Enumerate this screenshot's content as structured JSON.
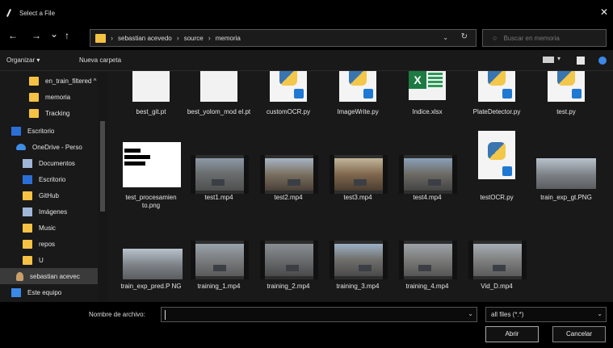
{
  "window": {
    "title": "Select a File",
    "close_glyph": "✕"
  },
  "nav": {
    "back": "←",
    "forward": "→",
    "recent": "⌄",
    "up": "↑",
    "breadcrumbs": [
      "sebastian acevedo",
      "source",
      "memoria"
    ],
    "dropdown_glyph": "⌄",
    "refresh_glyph": "↻",
    "search_placeholder": "Buscar en memoria"
  },
  "toolbar": {
    "organize": "Organizar ▾",
    "new_folder": "Nueva carpeta"
  },
  "sidebar": {
    "items": [
      {
        "label": "en_train_filtered ^",
        "icon": "folder"
      },
      {
        "label": "memoria",
        "icon": "folder"
      },
      {
        "label": "Tracking",
        "icon": "folder"
      },
      {
        "label": "Escritorio",
        "icon": "blue"
      },
      {
        "label": "OneDrive - Perso",
        "icon": "cloud"
      },
      {
        "label": "Documentos",
        "icon": "doc"
      },
      {
        "label": "Escritorio",
        "icon": "blue"
      },
      {
        "label": "GitHub",
        "icon": "folder"
      },
      {
        "label": "Imágenes",
        "icon": "doc"
      },
      {
        "label": "Music",
        "icon": "folder"
      },
      {
        "label": "repos",
        "icon": "folder"
      },
      {
        "label": "U",
        "icon": "folder"
      },
      {
        "label": "sebastian acevec",
        "icon": "user"
      },
      {
        "label": "Este equipo",
        "icon": "pc"
      }
    ]
  },
  "files": {
    "row1": [
      "best_git.pt",
      "best_yolom_mod el.pt",
      "customOCR.py",
      "ImageWrite.py",
      "Indice.xlsx",
      "PlateDetector.py",
      "test.py"
    ],
    "row2": [
      "test_procesamien to.png",
      "test1.mp4",
      "test2.mp4",
      "test3.mp4",
      "test4.mp4",
      "testOCR.py",
      "train_exp_gt.PNG"
    ],
    "row3": [
      "train_exp_pred.P NG",
      "training_1.mp4",
      "training_2.mp4",
      "training_3.mp4",
      "training_4.mp4",
      "Vid_D.mp4"
    ]
  },
  "bottom": {
    "filename_label": "Nombre de archivo:",
    "filter_value": "all files (*.*)",
    "dropdown_glyph": "⌄",
    "open_label": "Abrir",
    "cancel_label": "Cancelar"
  },
  "colors": {
    "folder": "#f5c243",
    "bg_panel": "#191919",
    "bg_chrome": "#000000",
    "accent": "#2b6fd6"
  }
}
